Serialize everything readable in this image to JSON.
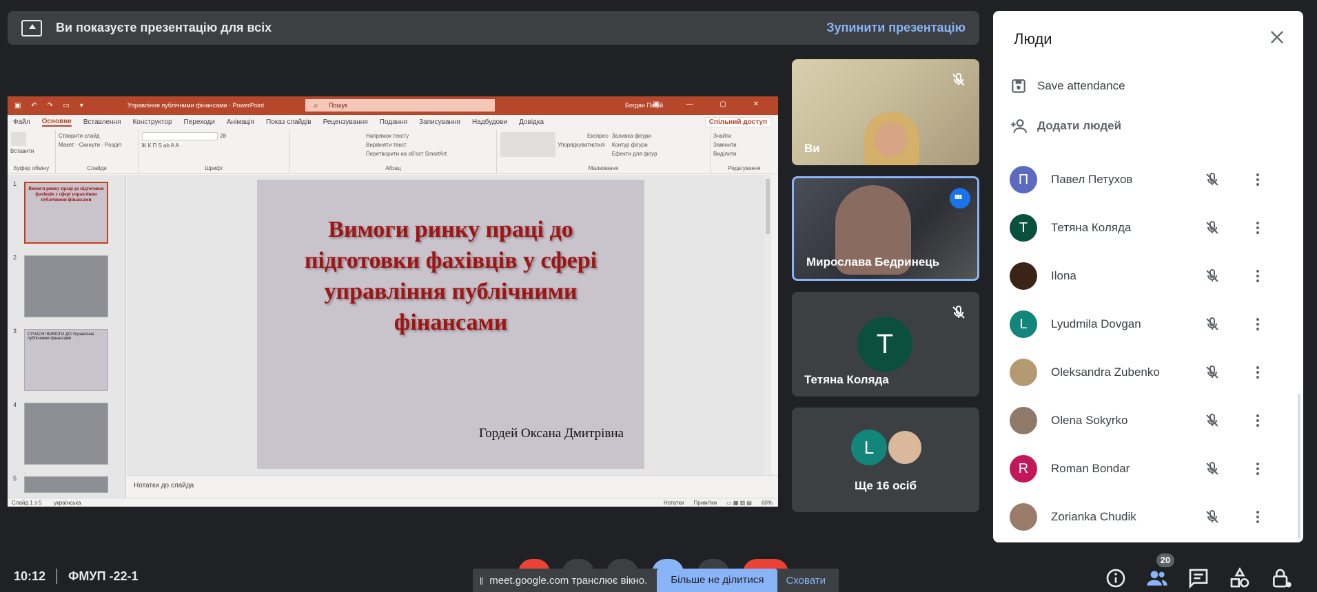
{
  "banner": {
    "text": "Ви показуєте презентацію для всіх",
    "stop_label": "Зупинити презентацію"
  },
  "ppt": {
    "title": "Управління публічними фінансами - PowerPoint",
    "search": "Пошук",
    "user": "Богдан Пацій",
    "menu": [
      "Файл",
      "Основне",
      "Вставлення",
      "Конструктор",
      "Переходи",
      "Анімація",
      "Показ слайдів",
      "Рецензування",
      "Подання",
      "Записування",
      "Надбудови",
      "Довідка"
    ],
    "share": "Спільний доступ",
    "groups": {
      "clipboard": "Буфер обміну",
      "slides": "Слайди",
      "font": "Шрифт",
      "paragraph": "Абзац",
      "drawing": "Малювання",
      "editing": "Редагування",
      "paste": "Вставити",
      "new_slide": "Створити слайд",
      "layout": "Макет",
      "reset": "Скинути",
      "section": "Розділ",
      "find": "Знайти",
      "replace": "Замінити",
      "select": "Виділити",
      "arrange": "Упорядкувати",
      "quick_styles": "Експрес-стилі",
      "fill": "Заливка фігури",
      "outline": "Контур фігури",
      "effects": "Ефекти для фігур",
      "text_dir": "Напрямок тексту",
      "align_text": "Вирівняти текст",
      "smartart": "Перетворити на об'єкт SmartArt",
      "font_size": "28"
    },
    "slide": {
      "title": "Вимоги ринку праці до підготовки фахівців у сфері управління публічними фінансами",
      "author": "Гордей Оксана Дмитрівна"
    },
    "thumbs": [
      {
        "num": "1",
        "text": "Вимоги ринку праці до підготовки фахівців у сфері управління публічними фінансами"
      },
      {
        "num": "2",
        "text": ""
      },
      {
        "num": "3",
        "text": "СУЧАСНІ ВИМОГИ ДО Управління публічними фінансами"
      },
      {
        "num": "4",
        "text": ""
      },
      {
        "num": "5",
        "text": ""
      }
    ],
    "notes": "Нотатки до слайда",
    "status_slide": "Слайд 1 з 5",
    "status_lang": "українська",
    "status_notes": "Нотатки",
    "status_comments": "Примітки",
    "zoom": "60%"
  },
  "tiles": [
    {
      "name": "Ви"
    },
    {
      "name": "Мирослава Бедринець"
    },
    {
      "name": "Тетяна Коляда",
      "initial": "T"
    },
    {
      "more": "Ще 16 осіб",
      "initial": "L"
    }
  ],
  "panel": {
    "title": "Люди",
    "save_attendance": "Save attendance",
    "add_people": "Додати людей",
    "people": [
      {
        "name": "Павел Петухов",
        "initial": "П",
        "color": "#5c6bc0"
      },
      {
        "name": "Тетяна Коляда",
        "initial": "T",
        "color": "#0b4f3f"
      },
      {
        "name": "Ilona",
        "initial": "",
        "color": "#3a2418"
      },
      {
        "name": "Lyudmila Dovgan",
        "initial": "L",
        "color": "#12867a"
      },
      {
        "name": "Oleksandra Zubenko",
        "initial": "",
        "color": "#b39a73"
      },
      {
        "name": "Olena Sokyrko",
        "initial": "",
        "color": "#8f7a6a"
      },
      {
        "name": "Roman Bondar",
        "initial": "R",
        "color": "#c2185b"
      },
      {
        "name": "Zorianka Chudik",
        "initial": "",
        "color": "#9b7b6a"
      }
    ]
  },
  "bottom": {
    "time": "10:12",
    "meeting": "ФМУП -22-1",
    "share_text": "meet.google.com транслює вікно.",
    "stop_share": "Більше не ділитися",
    "hide": "Сховати",
    "participants_count": "20"
  },
  "colors": {
    "accent": "#8ab4f8",
    "ppt_red": "#b7472a",
    "background": "#202124"
  }
}
